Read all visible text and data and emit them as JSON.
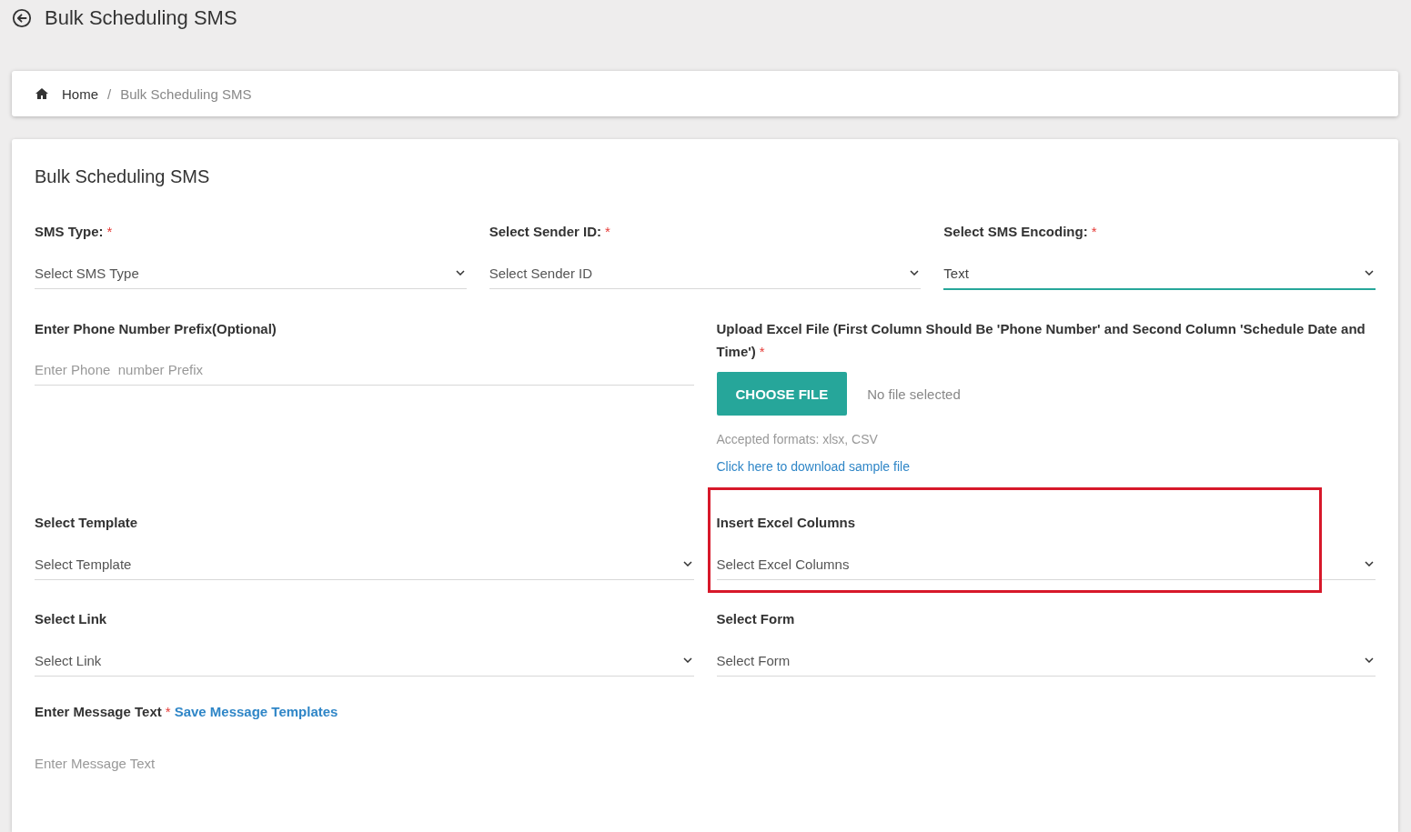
{
  "page_title": "Bulk Scheduling SMS",
  "breadcrumb": {
    "separator": "/",
    "items": [
      {
        "label": "Home",
        "kind": "link"
      },
      {
        "label": "Bulk Scheduling SMS",
        "kind": "current"
      }
    ]
  },
  "form": {
    "title": "Bulk Scheduling SMS",
    "rows": [
      [
        {
          "kind": "select",
          "label": "SMS Type:",
          "required_mark": "*",
          "placeholder": "Select SMS Type",
          "focused": false
        },
        {
          "kind": "select",
          "label": "Select Sender ID:",
          "required_mark": "*",
          "placeholder": "Select Sender ID",
          "focused": false
        },
        {
          "kind": "select",
          "label": "Select SMS Encoding:",
          "required_mark": "*",
          "value": "Text",
          "focused": true
        }
      ],
      [
        {
          "kind": "text",
          "label": "Enter Phone Number Prefix(Optional)",
          "placeholder": "Enter Phone  number Prefix"
        },
        {
          "kind": "file",
          "label": "Upload Excel File (First Column Should Be 'Phone Number' and Second Column 'Schedule Date and Time')",
          "required_mark": "*",
          "button": "CHOOSE FILE",
          "status": "No file selected",
          "hint": "Accepted formats: xlsx, CSV",
          "link": "Click here to download sample file"
        }
      ],
      [
        {
          "kind": "select",
          "label": "Select Template",
          "placeholder": "Select Template",
          "focused": false
        },
        {
          "kind": "select",
          "label": "Insert Excel Columns",
          "placeholder": "Select Excel Columns",
          "focused": false,
          "highlighted": true
        }
      ],
      [
        {
          "kind": "select",
          "label": "Select Link",
          "placeholder": "Select Link",
          "focused": false
        },
        {
          "kind": "select",
          "label": "Select Form",
          "placeholder": "Select Form",
          "focused": false
        }
      ],
      [
        {
          "kind": "textarea",
          "label": "Enter Message Text",
          "required_mark": "*",
          "action_link": "Save Message Templates",
          "placeholder": "Enter Message Text"
        }
      ]
    ]
  }
}
